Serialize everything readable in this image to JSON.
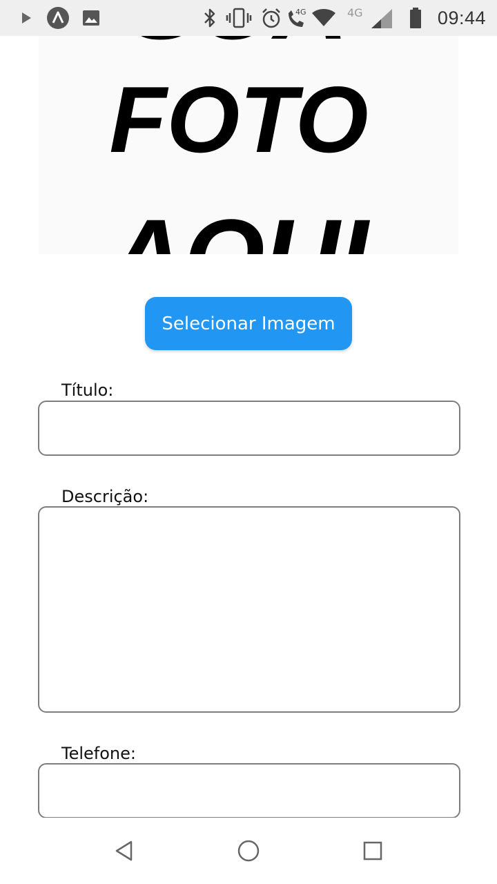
{
  "status_bar": {
    "time": "09:44",
    "network_label_1": "4G",
    "network_label_2": "4G",
    "icons": [
      "play-store-icon",
      "app-icon",
      "image-icon",
      "bluetooth-icon",
      "vibrate-icon",
      "alarm-icon",
      "wifi-calling-icon",
      "wifi-icon",
      "signal-icon",
      "battery-icon"
    ]
  },
  "photo": {
    "line_top": "SUA",
    "line_middle": "FOTO",
    "line_bottom": "AQUI"
  },
  "select_button": {
    "label": "Selecionar Imagem",
    "color": "#2196f3"
  },
  "form": {
    "titulo_label": "Título:",
    "titulo_value": "",
    "descricao_label": "Descrição:",
    "descricao_value": "",
    "telefone_label": "Telefone:",
    "telefone_value": ""
  },
  "nav_bar": {
    "icons": [
      "back-icon",
      "home-icon",
      "recents-icon"
    ]
  }
}
